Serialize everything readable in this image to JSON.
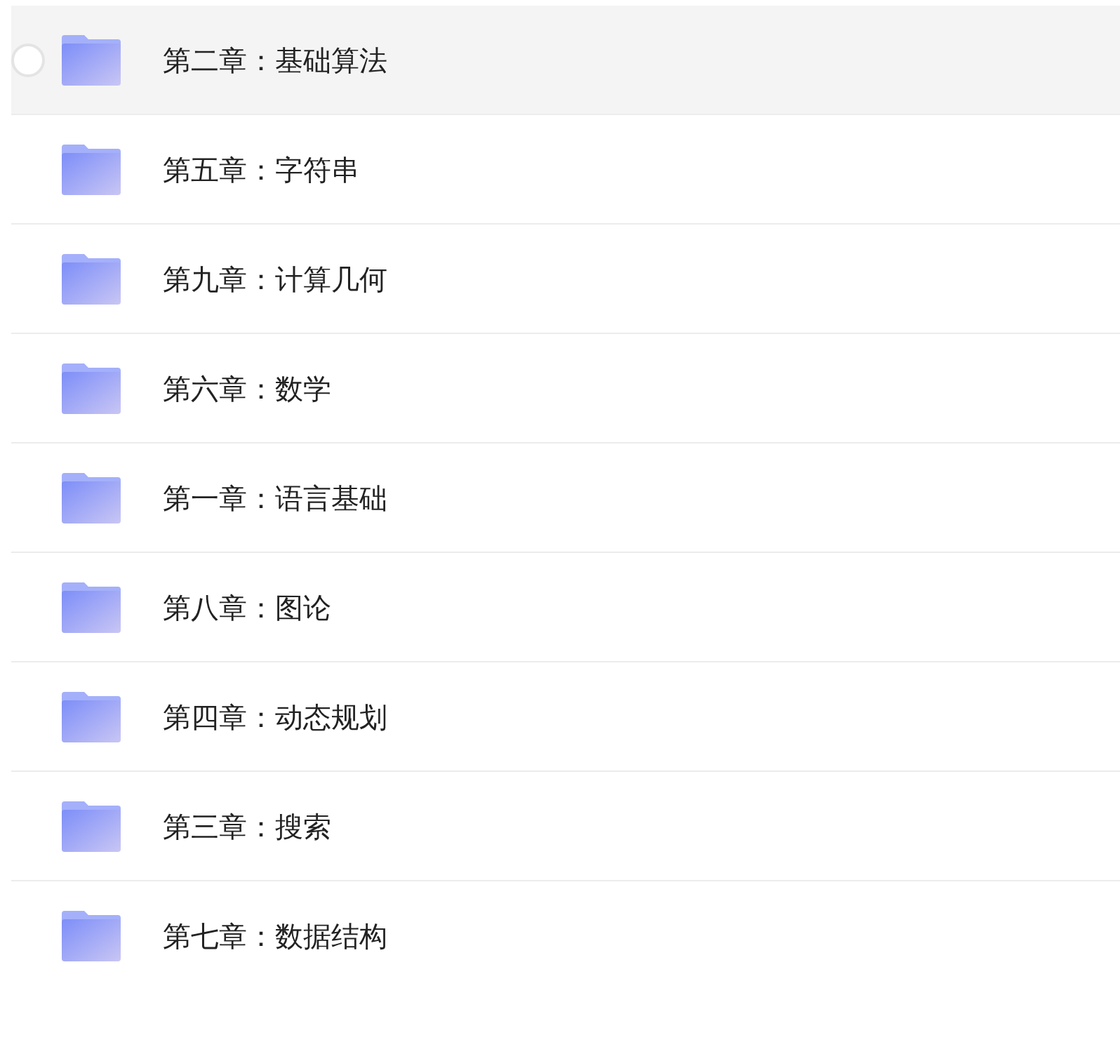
{
  "folders": [
    {
      "name": "第二章：基础算法",
      "hovered": true
    },
    {
      "name": "第五章：字符串",
      "hovered": false
    },
    {
      "name": "第九章：计算几何",
      "hovered": false
    },
    {
      "name": "第六章：数学",
      "hovered": false
    },
    {
      "name": "第一章：语言基础",
      "hovered": false
    },
    {
      "name": "第八章：图论",
      "hovered": false
    },
    {
      "name": "第四章：动态规划",
      "hovered": false
    },
    {
      "name": "第三章：搜索",
      "hovered": false
    },
    {
      "name": "第七章：数据结构",
      "hovered": false
    }
  ]
}
